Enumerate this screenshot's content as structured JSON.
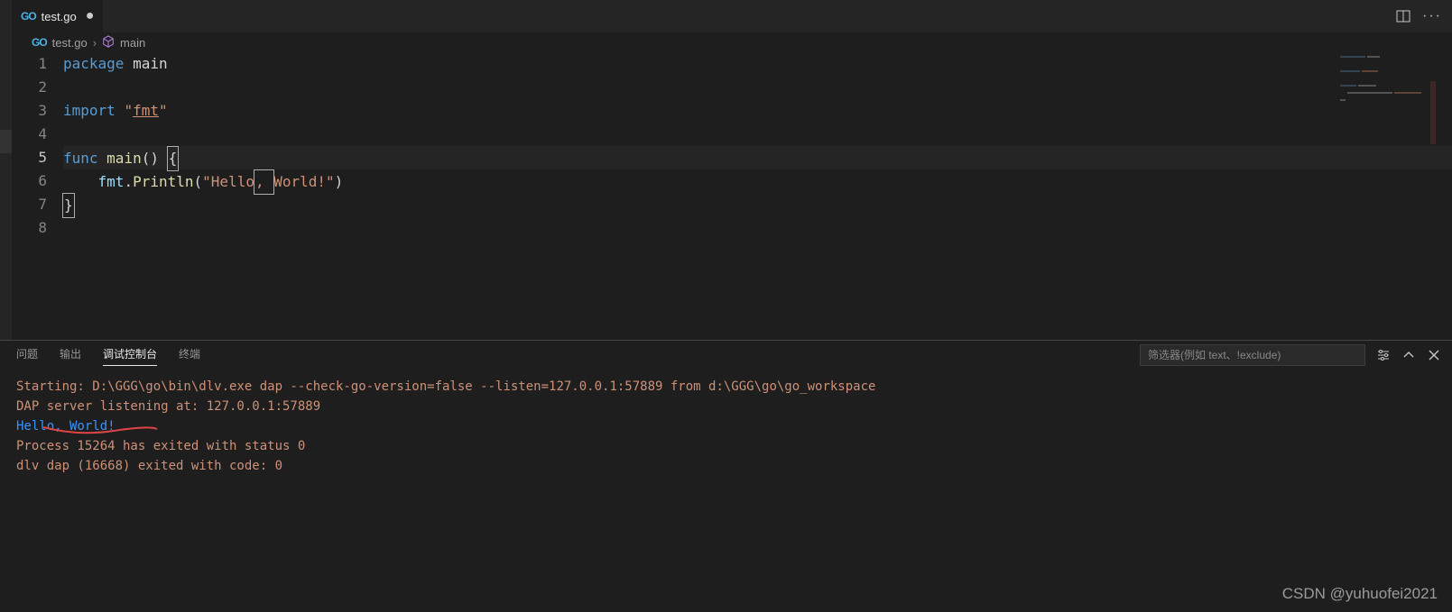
{
  "tab": {
    "filename": "test.go",
    "dirty_marker": "●"
  },
  "breadcrumb": {
    "file": "test.go",
    "symbol": "main"
  },
  "code": {
    "lines": [
      {
        "n": "1",
        "tokens": [
          {
            "t": "package ",
            "c": "kw"
          },
          {
            "t": "main",
            "c": "ident"
          }
        ]
      },
      {
        "n": "2",
        "tokens": []
      },
      {
        "n": "3",
        "tokens": [
          {
            "t": "import ",
            "c": "kw"
          },
          {
            "t": "\"",
            "c": "str"
          },
          {
            "t": "fmt",
            "c": "str",
            "u": true
          },
          {
            "t": "\"",
            "c": "str"
          }
        ]
      },
      {
        "n": "4",
        "tokens": []
      },
      {
        "n": "5",
        "tokens": [
          {
            "t": "func ",
            "c": "kw"
          },
          {
            "t": "main",
            "c": "fn"
          },
          {
            "t": "() ",
            "c": "ident"
          },
          {
            "t": "{",
            "c": "ident",
            "box": true
          }
        ],
        "active": true
      },
      {
        "n": "6",
        "tokens": [
          {
            "t": "    ",
            "c": ""
          },
          {
            "t": "fmt",
            "c": "pkg"
          },
          {
            "t": ".",
            "c": "ident"
          },
          {
            "t": "Println",
            "c": "fn"
          },
          {
            "t": "(",
            "c": "ident"
          },
          {
            "t": "\"Hello",
            "c": "str"
          },
          {
            "t": ", ",
            "c": "str",
            "box": true
          },
          {
            "t": "World!\"",
            "c": "str"
          },
          {
            "t": ")",
            "c": "ident"
          }
        ]
      },
      {
        "n": "7",
        "tokens": [
          {
            "t": "}",
            "c": "ident",
            "box": true
          }
        ]
      },
      {
        "n": "8",
        "tokens": []
      }
    ]
  },
  "panel": {
    "tabs": [
      {
        "label": "问题",
        "id": "problems"
      },
      {
        "label": "输出",
        "id": "output"
      },
      {
        "label": "调试控制台",
        "id": "debug",
        "active": true
      },
      {
        "label": "终端",
        "id": "terminal"
      }
    ],
    "filter_placeholder": "筛选器(例如 text、!exclude)"
  },
  "console": {
    "lines": [
      {
        "text": "Starting: D:\\GGG\\go\\bin\\dlv.exe dap --check-go-version=false --listen=127.0.0.1:57889 from d:\\GGG\\go\\go_workspace",
        "c": "l-orange"
      },
      {
        "text": "DAP server listening at: 127.0.0.1:57889",
        "c": "l-orange"
      },
      {
        "text": "Hello, World!",
        "c": "l-blue"
      },
      {
        "text": "Process 15264 has exited with status 0",
        "c": "l-orange"
      },
      {
        "text": "dlv dap (16668) exited with code: 0",
        "c": "l-orange"
      }
    ]
  },
  "watermark": "CSDN @yuhuofei2021"
}
